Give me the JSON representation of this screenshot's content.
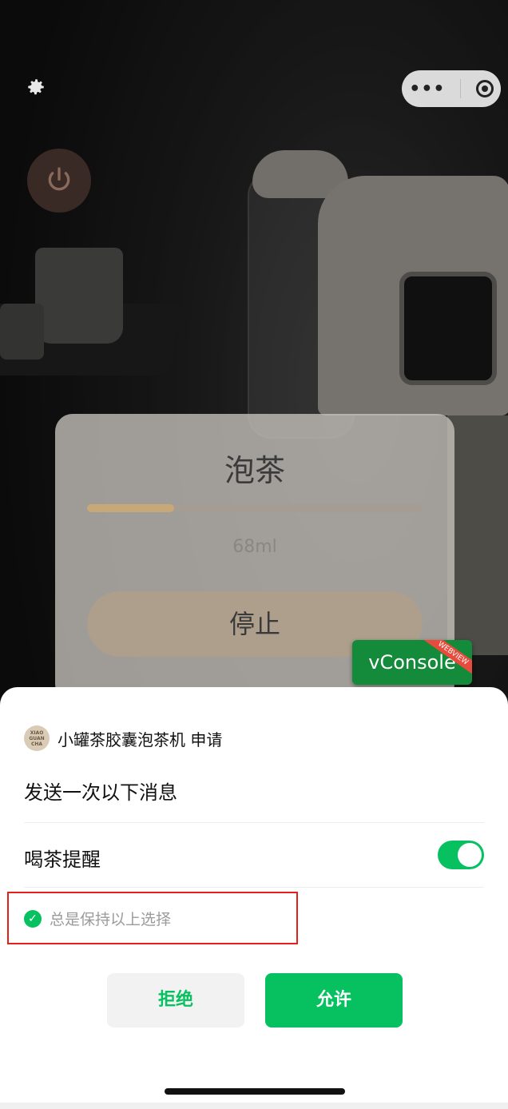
{
  "top": {
    "capsule_more": "•••"
  },
  "card": {
    "title": "泡茶",
    "progress": 0.26,
    "volume": "68ml",
    "stop_label": "停止"
  },
  "vconsole": {
    "label": "vConsole",
    "ribbon": "WEBVIEW"
  },
  "dialog": {
    "app_logo_text": "XIAO GUAN CHA",
    "app_name": "小罐茶胶囊泡茶机 申请",
    "message_title": "发送一次以下消息",
    "item_label": "喝茶提醒",
    "item_enabled": true,
    "keep_choice": "总是保持以上选择",
    "reject_label": "拒绝",
    "allow_label": "允许"
  },
  "colors": {
    "accent": "#07c160",
    "highlight_box": "#e32119",
    "progress_fill": "#c9a877"
  }
}
